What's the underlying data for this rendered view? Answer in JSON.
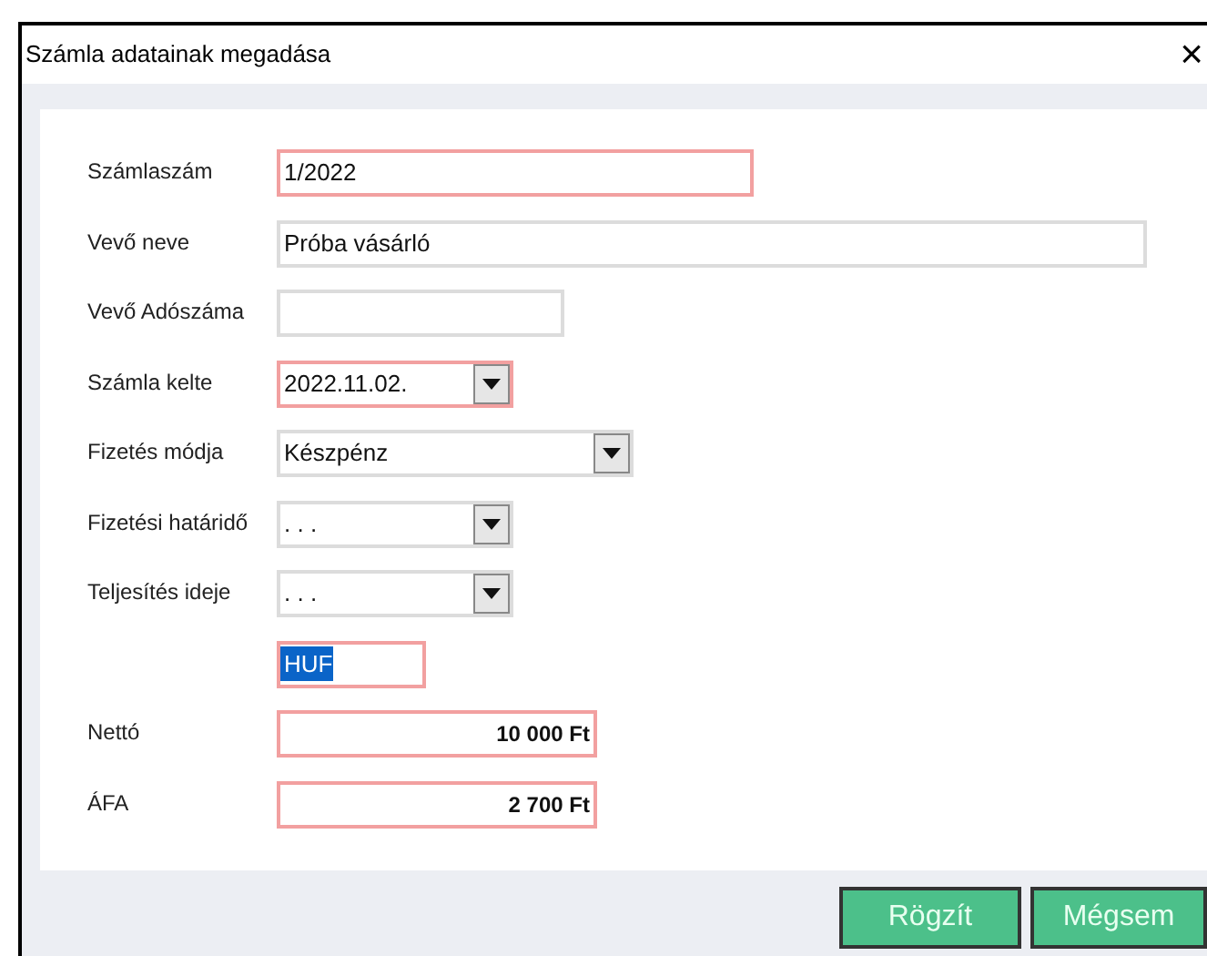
{
  "window": {
    "title": "Számla adatainak megadása",
    "close": "×"
  },
  "fields": [
    {
      "label": "Számlaszám",
      "kind": "text",
      "value": "1/2022",
      "required": true,
      "text_selected": false
    },
    {
      "label": "Vevő neve",
      "kind": "text",
      "value": "Próba vásárló",
      "required": false,
      "text_selected": false
    },
    {
      "label": "Vevő Adószáma",
      "kind": "text",
      "required": false
    },
    {
      "label": "Számla kelte",
      "kind": "dropdown",
      "value": "2022.11.02.",
      "required": true,
      "text_selected": false
    },
    {
      "label": "Fizetés módja",
      "kind": "dropdown",
      "value": "Készpénz",
      "required": false,
      "text_selected": false
    },
    {
      "label": "Fizetési határidő",
      "kind": "dropdown",
      "value": ". . .",
      "required": false,
      "text_selected": false
    },
    {
      "label": "Teljesítés ideje",
      "kind": "dropdown",
      "value": ". . .",
      "required": false,
      "text_selected": false
    },
    {
      "kind": "text",
      "value": "HUF",
      "required": true,
      "text_selected": true
    },
    {
      "label": "Nettó",
      "kind": "amount",
      "value": "10 000 Ft",
      "required": true,
      "text_selected": false
    },
    {
      "label": "ÁFA",
      "kind": "amount",
      "value": "2 700 Ft",
      "required": true,
      "text_selected": false
    }
  ],
  "buttons": [
    "Rögzít",
    "Mégsem"
  ]
}
